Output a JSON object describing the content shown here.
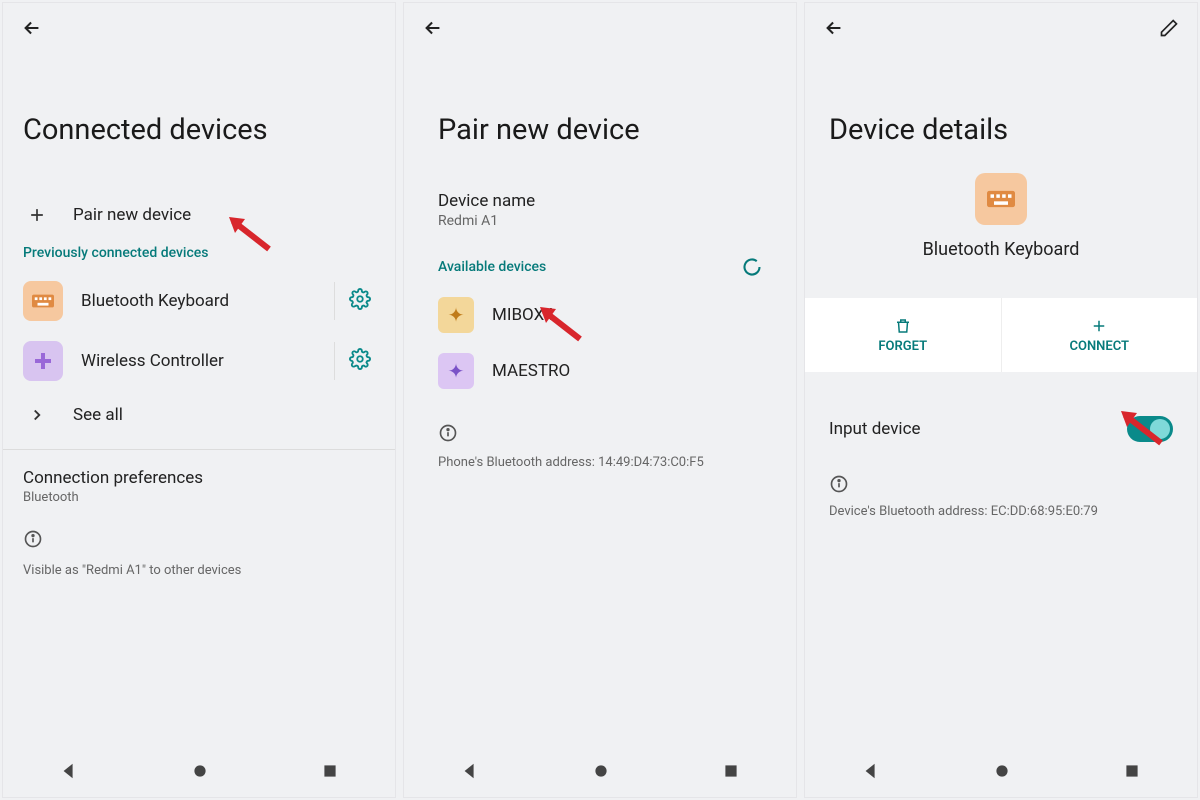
{
  "screens": {
    "connected": {
      "title": "Connected devices",
      "pair_label": "Pair new device",
      "previously_header": "Previously connected devices",
      "devices": [
        {
          "name": "Bluetooth Keyboard"
        },
        {
          "name": "Wireless Controller"
        }
      ],
      "see_all": "See all",
      "pref_title": "Connection preferences",
      "pref_sub": "Bluetooth",
      "visible_text": "Visible as \"Redmi A1\" to other devices"
    },
    "pair": {
      "title": "Pair new device",
      "device_name_label": "Device name",
      "device_name_value": "Redmi A1",
      "available_header": "Available devices",
      "available": [
        {
          "name": "MIBOX4"
        },
        {
          "name": "MAESTRO"
        }
      ],
      "address_text": "Phone's Bluetooth address: 14:49:D4:73:C0:F5"
    },
    "details": {
      "title": "Device details",
      "device_name": "Bluetooth Keyboard",
      "forget_label": "FORGET",
      "connect_label": "CONNECT",
      "toggle_label": "Input device",
      "address_text": "Device's Bluetooth address: EC:DD:68:95:E0:79"
    }
  }
}
